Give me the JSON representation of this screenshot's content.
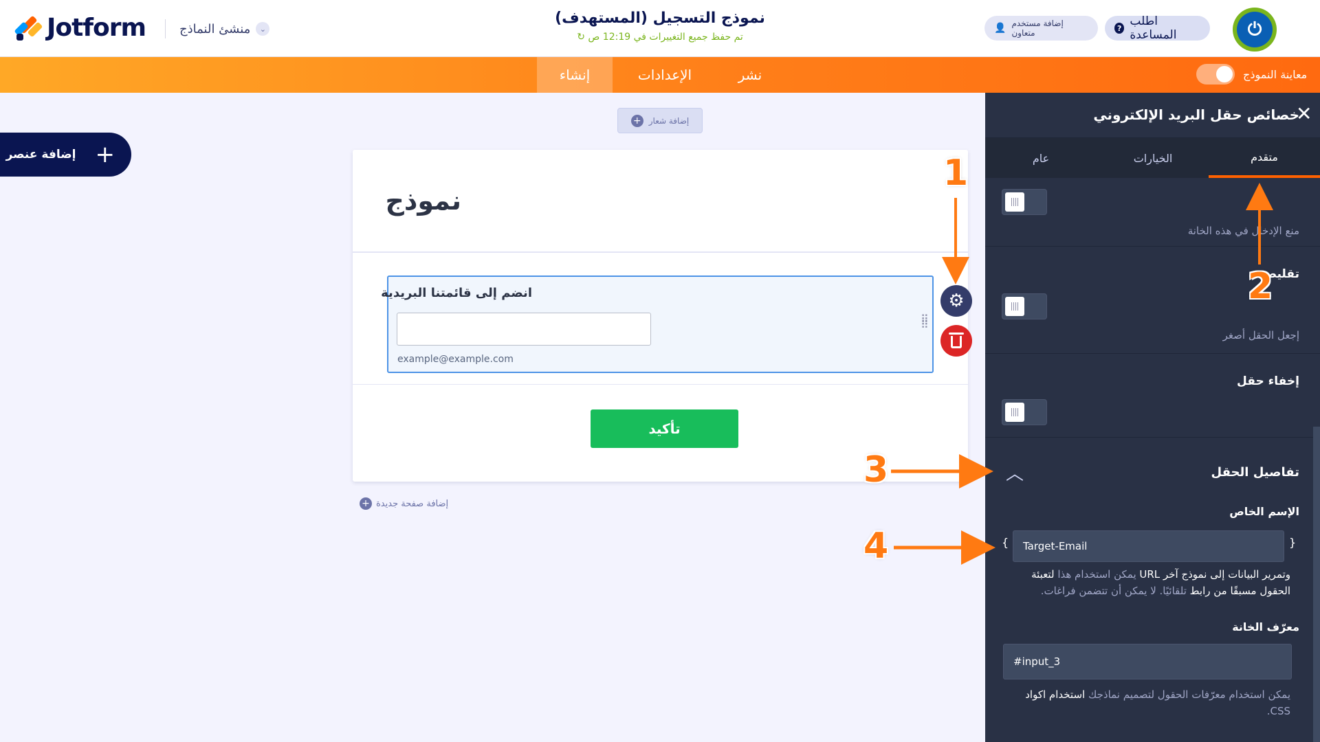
{
  "header": {
    "logo_text": "Jotform",
    "builder_label": "منشئ النماذج",
    "form_title": "نموذج التسجيل (المستهدف)",
    "save_status": "↻ تم حفظ جميع التغييرات في 12:19 ص",
    "help_button": "اطلب المساعدة",
    "invite_button": "إضافة مستخدم متعاون"
  },
  "navbar": {
    "tabs": [
      {
        "label": "إنشاء",
        "active": true
      },
      {
        "label": "الإعدادات",
        "active": false
      },
      {
        "label": "نشر",
        "active": false
      }
    ],
    "preview_label": "معاينة النموذج"
  },
  "canvas": {
    "add_element_label": "إضافة عنصر",
    "add_logo_label": "إضافة شعار",
    "form_heading": "نموذج",
    "field_label": "انضم إلى قائمتنا البريدية",
    "field_value": "",
    "field_sublabel": "example@example.com",
    "submit_label": "تأكيد",
    "add_page_label": "إضافة صفحة جديدة"
  },
  "panel": {
    "title": "خصائص حقل البريد الإلكتروني",
    "tabs": [
      "عام",
      "الخيارات",
      "متقدم"
    ],
    "active_tab": "متقدم",
    "readonly_desc": "منع الإدخال في هذه الخانة",
    "shrink_title": "تقليص",
    "shrink_desc": "إجعل الحقل أصغر",
    "hide_title": "إخفاء حقل",
    "details_title": "تفاصيل الحقل",
    "unique_name_label": "الإسم الخاص",
    "unique_name_value": "Target-Email",
    "unique_name_help_1": "يمكن استخدام هذا",
    "unique_name_help_2": "لتعبئة الحقول مسبقًا من رابط",
    "unique_name_help_3": "URL",
    "unique_name_help_4": "وتمرير البيانات إلى نموذج آخر",
    "unique_name_help_5": "تلقائيًا. لا يمكن أن تتضمن فراغات.",
    "field_id_label": "معرّف الخانة",
    "field_id_value": "#input_3",
    "field_id_help_1": "يمكن استخدام معرّفات الحقول لتصميم نماذجك",
    "field_id_help_2": "استخدام اكواد",
    "field_id_help_3": "CSS."
  },
  "annotations": [
    "1",
    "2",
    "3",
    "4"
  ],
  "colors": {
    "accent_orange": "#ff6100",
    "navy": "#0a1551",
    "panel_bg": "#293145",
    "submit_green": "#18bd5b",
    "delete_red": "#dc2626",
    "field_border": "#4c93e6"
  }
}
